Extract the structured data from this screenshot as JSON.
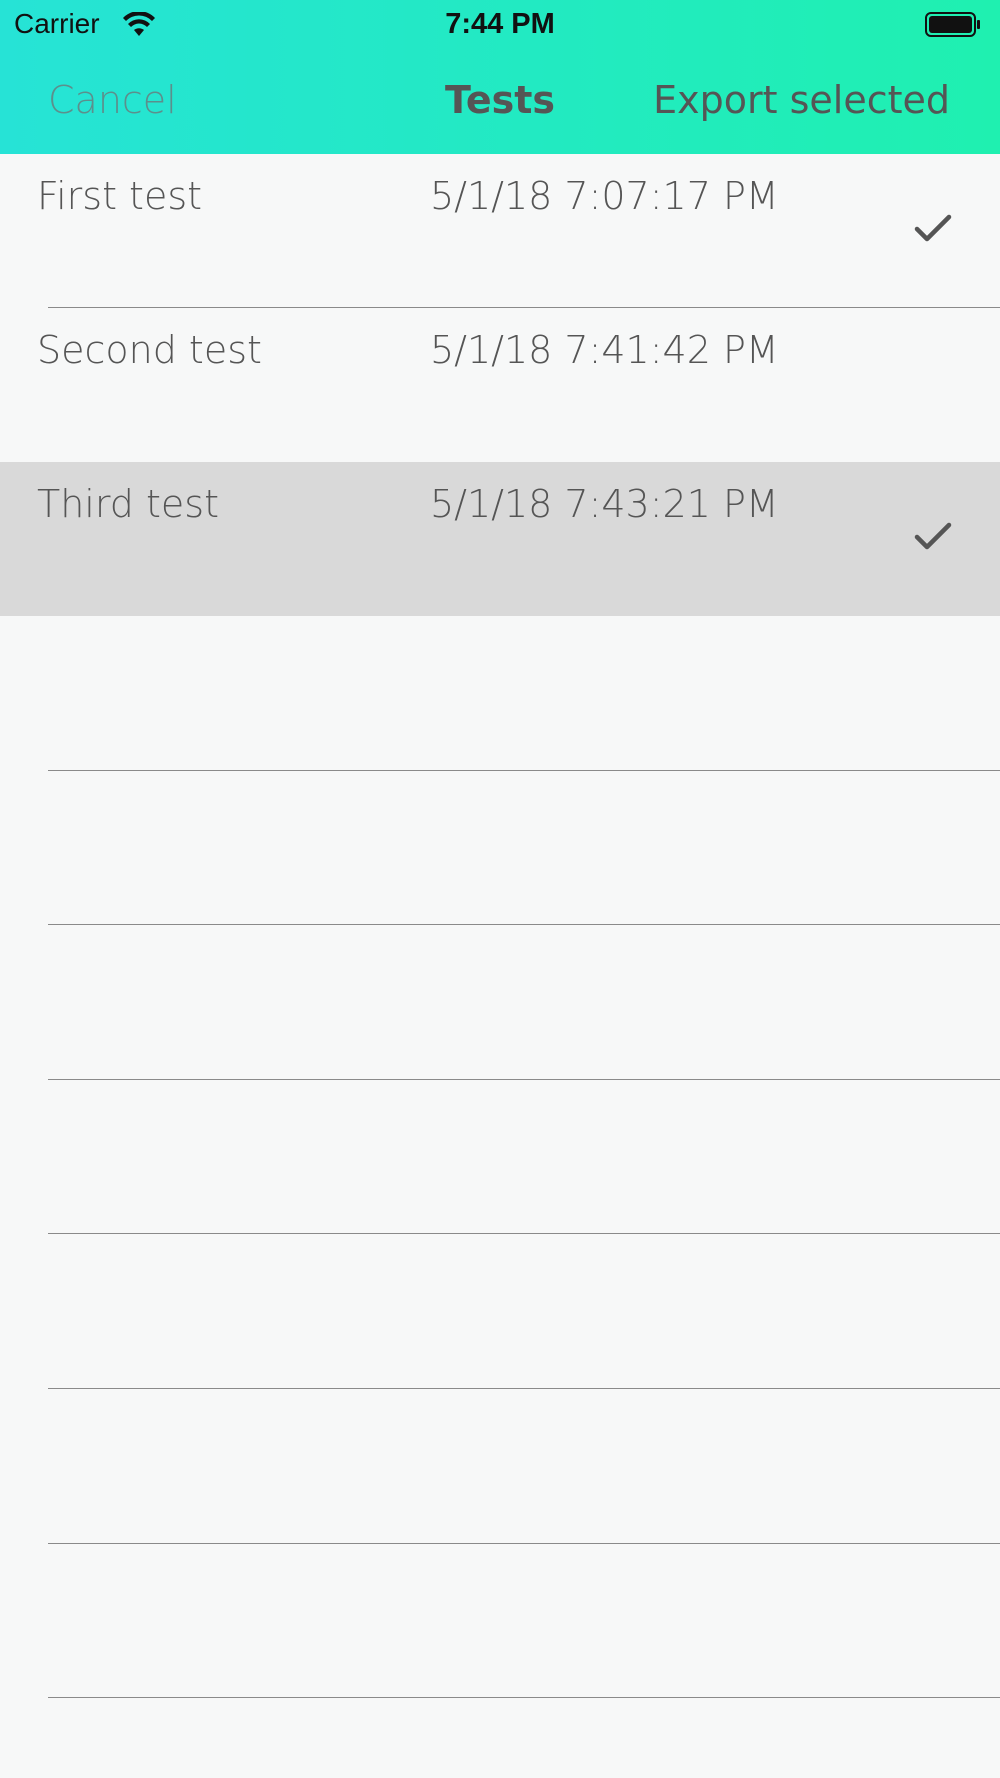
{
  "status_bar": {
    "carrier": "Carrier",
    "time": "7:44 PM",
    "wifi_icon": "wifi-icon",
    "battery_icon": "battery-full-icon"
  },
  "nav_bar": {
    "cancel_label": "Cancel",
    "title": "Tests",
    "export_label": "Export selected"
  },
  "tests": [
    {
      "name": "First test",
      "date": "5/1/18 7:07:17 PM",
      "checked": true,
      "highlighted": false
    },
    {
      "name": "Second test",
      "date": "5/1/18 7:41:42 PM",
      "checked": false,
      "highlighted": false
    },
    {
      "name": "Third test",
      "date": "5/1/18 7:43:21 PM",
      "checked": true,
      "highlighted": true
    }
  ],
  "colors": {
    "header_gradient_start": "#26e3d6",
    "header_gradient_end": "#1ff0b0",
    "text": "#555555",
    "cancel": "#5c8f8c",
    "selected_row": "#d9d9d9",
    "background": "#f7f8f8"
  }
}
